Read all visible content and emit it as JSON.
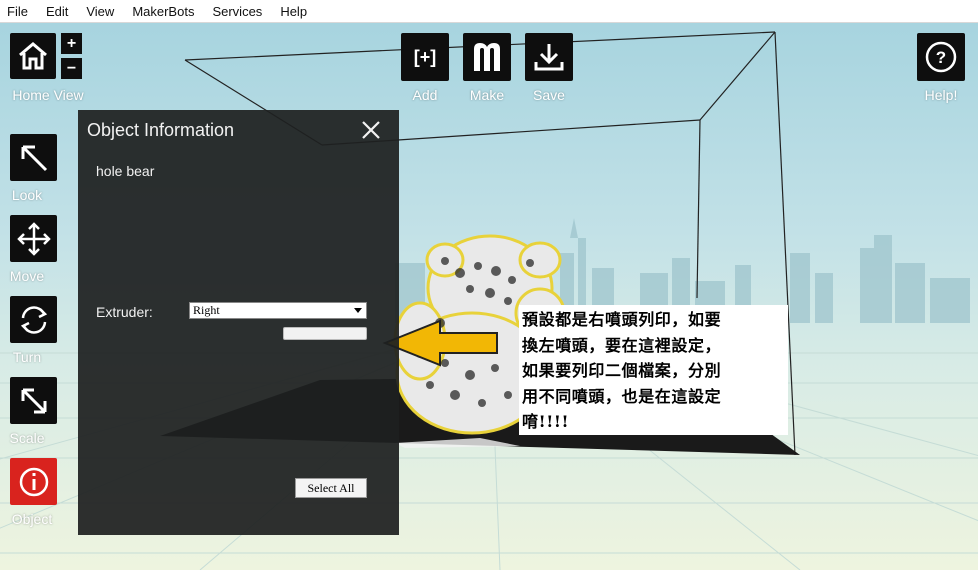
{
  "menubar": {
    "items": [
      "File",
      "Edit",
      "View",
      "MakerBots",
      "Services",
      "Help"
    ]
  },
  "toolbar": {
    "home_view": "Home View",
    "zoom_in": "+",
    "zoom_out": "−",
    "add": "Add",
    "add_icon_text": "[+]",
    "make": "Make",
    "save": "Save",
    "help": "Help!",
    "help_icon_text": "?"
  },
  "sidebar": {
    "items": [
      {
        "label": "Look",
        "icon": "look-arrow-icon"
      },
      {
        "label": "Move",
        "icon": "move-arrows-icon"
      },
      {
        "label": "Turn",
        "icon": "turn-rotate-icon"
      },
      {
        "label": "Scale",
        "icon": "scale-arrow-icon"
      },
      {
        "label": "Object",
        "icon": "info-icon",
        "active": true
      }
    ]
  },
  "object_info": {
    "title": "Object Information",
    "object_name": "hole bear",
    "extruder_label": "Extruder:",
    "extruder_value": "Right",
    "select_all": "Select All"
  },
  "annotation": {
    "text": "預設都是右噴頭列印，如要\n換左噴頭，要在這裡設定，\n如果要列印二個檔案，分別\n用不同噴頭，也是在這設定\n唷!!!!"
  },
  "colors": {
    "button_bg": "#0e0e0e",
    "object_button_bg": "#d9231e",
    "panel_bg": "#1e2020",
    "arrow_fill": "#f2b705"
  }
}
